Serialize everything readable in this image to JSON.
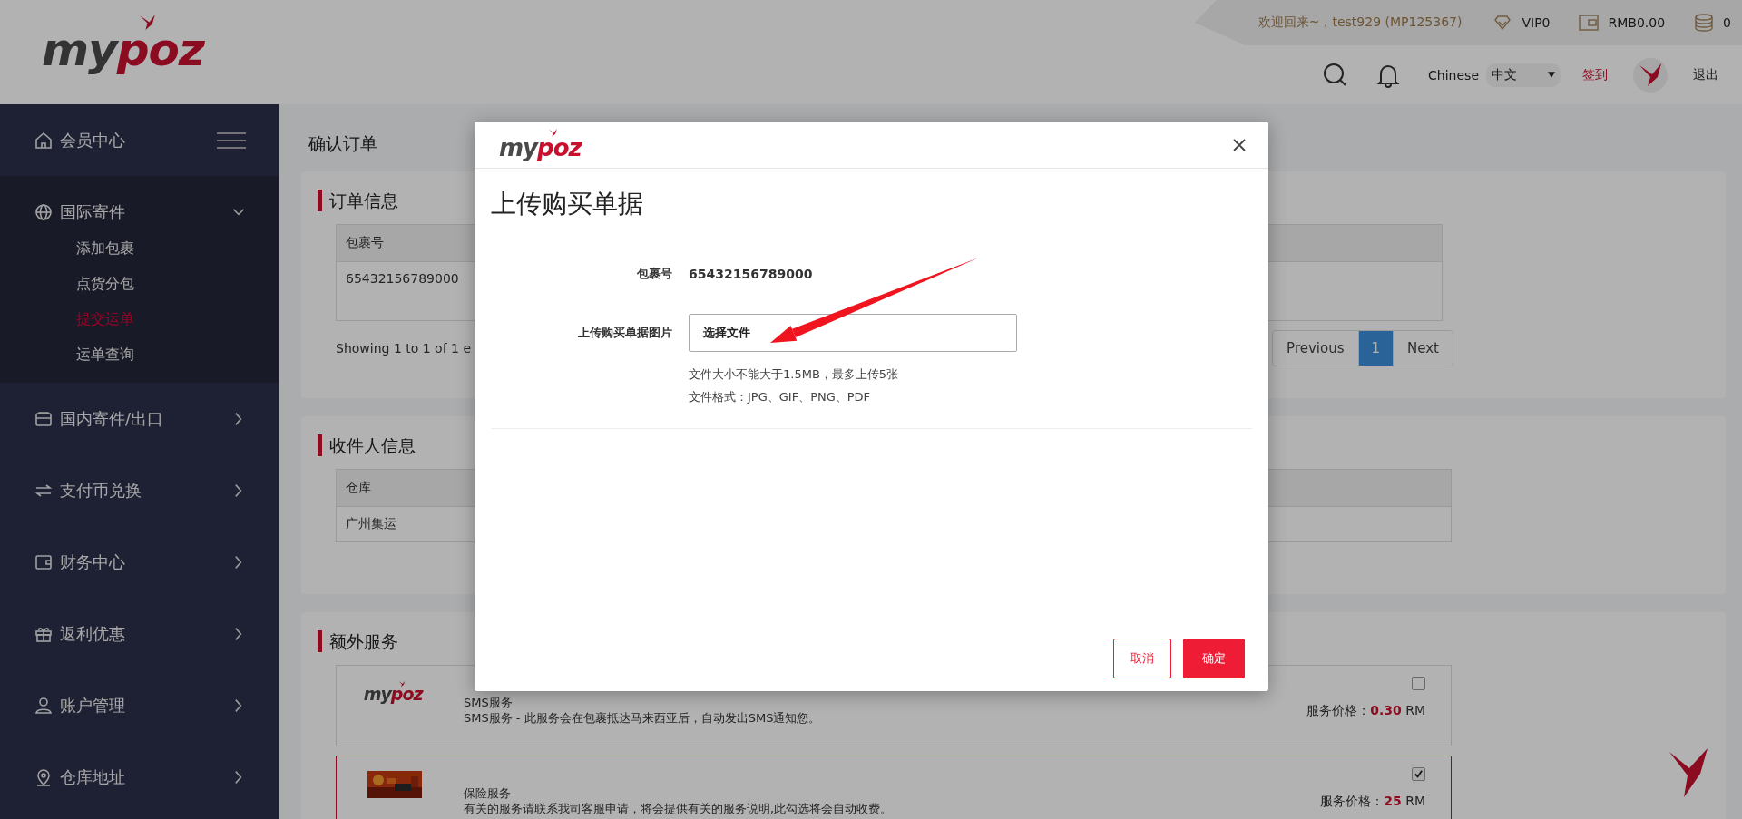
{
  "header": {
    "logo": {
      "lead": "my",
      "accent": "poz"
    },
    "top_bar": {
      "welcome": "欢迎回来~，test929 (MP125367)",
      "vip": "VIP0",
      "balance": "RMB0.00",
      "coins": "0"
    },
    "nav": {
      "language": "Chinese",
      "language_select": "中文",
      "checkin": "签到",
      "logout": "退出"
    }
  },
  "sidebar": {
    "title": "会员中心",
    "items": [
      {
        "label": "国际寄件",
        "expanded": true,
        "children": [
          {
            "label": "添加包裹",
            "selected": false
          },
          {
            "label": "点货分包",
            "selected": false
          },
          {
            "label": "提交运单",
            "selected": true
          },
          {
            "label": "运单查询",
            "selected": false
          }
        ]
      },
      {
        "label": "国内寄件/出口",
        "expanded": false
      },
      {
        "label": "支付币兑换",
        "expanded": false
      },
      {
        "label": "财务中心",
        "expanded": false
      },
      {
        "label": "返利优惠",
        "expanded": false
      },
      {
        "label": "账户管理",
        "expanded": false
      },
      {
        "label": "仓库地址",
        "expanded": false
      }
    ]
  },
  "page_title": "确认订单",
  "order_info": {
    "title": "订单信息",
    "table": {
      "columns": [
        "包裹号"
      ],
      "rows": [
        [
          "65432156789000"
        ]
      ]
    },
    "info": "Showing 1 to 1 of 1 e",
    "pagination": [
      {
        "label": "Previous",
        "selected": false
      },
      {
        "label": "1",
        "selected": true
      },
      {
        "label": "Next",
        "selected": false
      }
    ]
  },
  "recipient_info": {
    "title": "收件人信息",
    "table": {
      "columns": [
        "仓库"
      ],
      "rows": [
        [
          "广州集运"
        ]
      ]
    }
  },
  "extra_services": {
    "title": "额外服务",
    "items": [
      {
        "kind": "logo",
        "logo": {
          "lead": "my",
          "accent": "poz"
        },
        "title": "SMS服务",
        "description": "SMS服务 - 此服务会在包裹抵达马来西亚后，自动发出SMS通知您。",
        "checked": false,
        "price_label": "服务价格：",
        "price": "0.30",
        "unit": "RM"
      },
      {
        "kind": "picture",
        "title": "保险服务",
        "description": "有关的服务请联系我司客服申请，将会提供有关的服务说明,此勾选将会自动收费。",
        "checked": true,
        "price_label": "服务价格：",
        "price": "25",
        "unit": "RM"
      }
    ]
  },
  "modal": {
    "logo": {
      "lead": "my",
      "accent": "poz"
    },
    "title": "上传购买单据",
    "fields": [
      {
        "kind": "value",
        "label": "包裹号",
        "value": "65432156789000"
      },
      {
        "kind": "file",
        "label": "上传购买单据图片",
        "button": "选择文件",
        "hints": [
          "文件大小不能大于1.5MB，最多上传5张",
          "文件格式：JPG、GIF、PNG、PDF"
        ]
      }
    ],
    "buttons": [
      {
        "kind": "cancel",
        "label": "取消"
      },
      {
        "kind": "confirm",
        "label": "确定"
      }
    ]
  }
}
